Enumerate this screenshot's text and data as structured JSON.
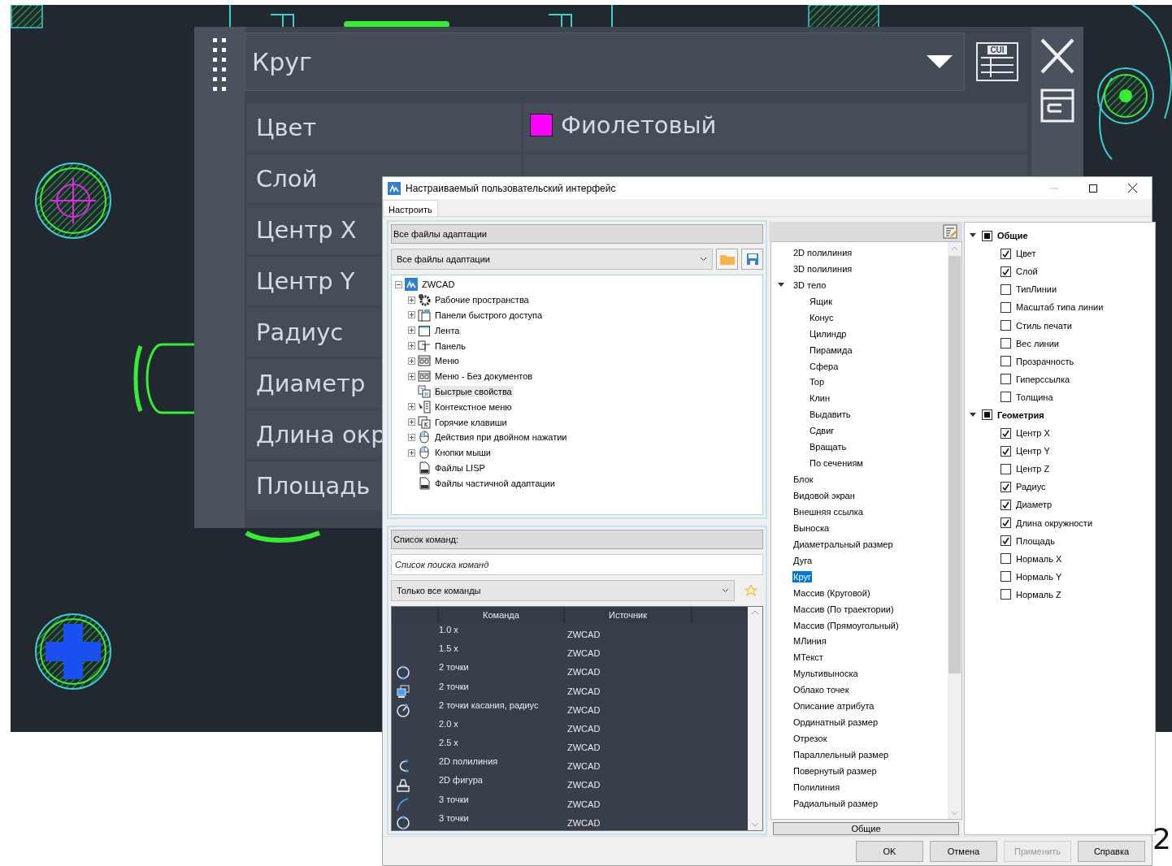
{
  "quick_properties": {
    "object_type": "Круг",
    "cui_label": "CUI",
    "rows": [
      {
        "label": "Цвет",
        "value": "Фиолетовый",
        "color": "#ff00ff"
      },
      {
        "label": "Слой"
      },
      {
        "label": "Центр X"
      },
      {
        "label": "Центр Y"
      },
      {
        "label": "Радиус"
      },
      {
        "label": "Диаметр"
      },
      {
        "label": "Длина окр"
      },
      {
        "label": "Площадь"
      }
    ]
  },
  "dialog": {
    "title": "Настраиваемый пользовательский интерфейс",
    "tabs": [
      {
        "label": "Настроить",
        "selected": true
      }
    ],
    "customizations": {
      "header": "Все файлы адаптации",
      "file_select": "Все файлы адаптации",
      "tree": {
        "label": "ZWCAD",
        "expanded": true,
        "children": [
          {
            "label": "Рабочие пространства",
            "kind": "gear",
            "expandable": true,
            "selected": false
          },
          {
            "label": "Панели быстрого доступа",
            "kind": "panels",
            "expandable": true,
            "selected": false
          },
          {
            "label": "Лента",
            "kind": "window",
            "expandable": true,
            "selected": false
          },
          {
            "label": "Панель",
            "kind": "toolbar",
            "expandable": true,
            "selected": false
          },
          {
            "label": "Меню",
            "kind": "menu",
            "expandable": true,
            "selected": false
          },
          {
            "label": "Меню - Без документов",
            "kind": "menu",
            "expandable": true,
            "selected": false
          },
          {
            "label": "Быстрые свойства",
            "kind": "properties",
            "expandable": false,
            "selected": true
          },
          {
            "label": "Контекстное меню",
            "kind": "context",
            "expandable": true,
            "selected": false
          },
          {
            "label": "Горячие клавиши",
            "kind": "keys",
            "expandable": true,
            "selected": false
          },
          {
            "label": "Действия при двойном нажатии",
            "kind": "mouse",
            "expandable": true,
            "selected": false
          },
          {
            "label": "Кнопки мыши",
            "kind": "mouse",
            "expandable": true,
            "selected": false
          },
          {
            "label": "Файлы LISP",
            "kind": "file",
            "expandable": false,
            "selected": false
          },
          {
            "label": "Файлы частичной адаптации",
            "kind": "file",
            "expandable": false,
            "selected": false
          }
        ]
      }
    },
    "commands": {
      "header": "Список команд:",
      "search": {
        "placeholder": "Список поиска команд"
      },
      "filter": "Только все команды",
      "columns": [
        "Команда",
        "Источник"
      ],
      "rows": [
        {
          "name": "1.0 x",
          "source": "ZWCAD",
          "kind": "none"
        },
        {
          "name": "1.5 x",
          "source": "ZWCAD",
          "kind": "none"
        },
        {
          "name": "2 точки",
          "source": "ZWCAD",
          "kind": "circle"
        },
        {
          "name": "2 точки",
          "source": "ZWCAD",
          "kind": "viewports"
        },
        {
          "name": "2 точки касания, радиус",
          "source": "ZWCAD",
          "kind": "tangent"
        },
        {
          "name": "2.0 x",
          "source": "ZWCAD",
          "kind": "none"
        },
        {
          "name": "2.5 x",
          "source": "ZWCAD",
          "kind": "none"
        },
        {
          "name": "2D полилиния",
          "source": "ZWCAD",
          "kind": "polyline"
        },
        {
          "name": "2D фигура",
          "source": "ZWCAD",
          "kind": "shape"
        },
        {
          "name": "3 точки",
          "source": "ZWCAD",
          "kind": "arc"
        },
        {
          "name": "3 точки",
          "source": "ZWCAD",
          "kind": "circle"
        }
      ]
    },
    "object_types": {
      "general_button": "Общие",
      "items": [
        {
          "label": "2D полилиния",
          "selected": false
        },
        {
          "label": "3D полилиния",
          "selected": false
        },
        {
          "label": "3D тело",
          "selected": false,
          "expanded": true,
          "children": [
            {
              "label": "Ящик",
              "selected": false
            },
            {
              "label": "Конус",
              "selected": false
            },
            {
              "label": "Цилиндр",
              "selected": false
            },
            {
              "label": "Пирамида",
              "selected": false
            },
            {
              "label": "Сфера",
              "selected": false
            },
            {
              "label": "Тор",
              "selected": false
            },
            {
              "label": "Клин",
              "selected": false
            },
            {
              "label": "Выдавить",
              "selected": false
            },
            {
              "label": "Сдвиг",
              "selected": false
            },
            {
              "label": "Вращать",
              "selected": false
            },
            {
              "label": "По сечениям",
              "selected": false
            }
          ]
        },
        {
          "label": "Блок",
          "selected": false
        },
        {
          "label": "Видовой экран",
          "selected": false
        },
        {
          "label": "Внешняя ссылка",
          "selected": false
        },
        {
          "label": "Выноска",
          "selected": false
        },
        {
          "label": "Диаметральный размер",
          "selected": false
        },
        {
          "label": "Дуга",
          "selected": false
        },
        {
          "label": "Круг",
          "selected": true
        },
        {
          "label": "Массив (Круговой)",
          "selected": false
        },
        {
          "label": "Массив (По траектории)",
          "selected": false
        },
        {
          "label": "Массив (Прямоугольный)",
          "selected": false
        },
        {
          "label": "МЛиния",
          "selected": false
        },
        {
          "label": "МТекст",
          "selected": false
        },
        {
          "label": "Мультивыноска",
          "selected": false
        },
        {
          "label": "Облако точек",
          "selected": false
        },
        {
          "label": "Описание атрибута",
          "selected": false
        },
        {
          "label": "Ординатный размер",
          "selected": false
        },
        {
          "label": "Отрезок",
          "selected": false
        },
        {
          "label": "Параллельный размер",
          "selected": false
        },
        {
          "label": "Повернутый размер",
          "selected": false
        },
        {
          "label": "Полилиния",
          "selected": false
        },
        {
          "label": "Радиальный размер",
          "selected": false
        }
      ]
    },
    "properties": {
      "groups": [
        {
          "label": "Общие",
          "expanded": true,
          "mixed": true,
          "items": [
            {
              "label": "Цвет",
              "checked": true
            },
            {
              "label": "Слой",
              "checked": true
            },
            {
              "label": "ТипЛинии",
              "checked": false
            },
            {
              "label": "Масштаб типа линии",
              "checked": false
            },
            {
              "label": "Стиль печати",
              "checked": false
            },
            {
              "label": "Вес линии",
              "checked": false
            },
            {
              "label": "Прозрачность",
              "checked": false
            },
            {
              "label": "Гиперссылка",
              "checked": false
            },
            {
              "label": "Толщина",
              "checked": false
            }
          ]
        },
        {
          "label": "Геометрия",
          "expanded": true,
          "mixed": true,
          "items": [
            {
              "label": "Центр X",
              "checked": true
            },
            {
              "label": "Центр Y",
              "checked": true
            },
            {
              "label": "Центр Z",
              "checked": false
            },
            {
              "label": "Радиус",
              "checked": true
            },
            {
              "label": "Диаметр",
              "checked": true
            },
            {
              "label": "Длина окружности",
              "checked": true
            },
            {
              "label": "Площадь",
              "checked": true
            },
            {
              "label": "Нормаль X",
              "checked": false
            },
            {
              "label": "Нормаль Y",
              "checked": false
            },
            {
              "label": "Нормаль Z",
              "checked": false
            }
          ]
        }
      ]
    },
    "buttons": [
      {
        "label": "OK",
        "disabled": false
      },
      {
        "label": "Отмена",
        "disabled": false
      },
      {
        "label": "Применить",
        "disabled": true
      },
      {
        "label": "Справка",
        "disabled": false
      }
    ]
  },
  "edge_text": "2"
}
